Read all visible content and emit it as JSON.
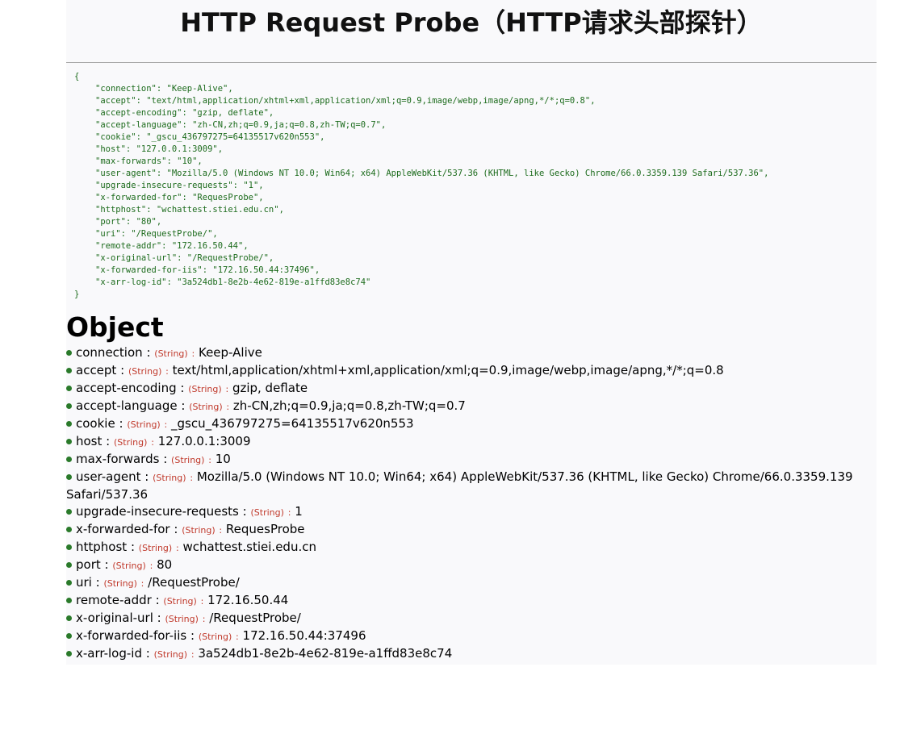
{
  "page": {
    "title": "HTTP Request Probe（HTTP请求头部探针）",
    "object_heading": "Object"
  },
  "raw_json": {
    "open": "{",
    "close": "}",
    "lines": [
      "\"connection\": \"Keep-Alive\",",
      "\"accept\": \"text/html,application/xhtml+xml,application/xml;q=0.9,image/webp,image/apng,*/*;q=0.8\",",
      "\"accept-encoding\": \"gzip, deflate\",",
      "\"accept-language\": \"zh-CN,zh;q=0.9,ja;q=0.8,zh-TW;q=0.7\",",
      "\"cookie\": \"_gscu_436797275=64135517v620n553\",",
      "\"host\": \"127.0.0.1:3009\",",
      "\"max-forwards\": \"10\",",
      "\"user-agent\": \"Mozilla/5.0 (Windows NT 10.0; Win64; x64) AppleWebKit/537.36 (KHTML, like Gecko) Chrome/66.0.3359.139 Safari/537.36\",",
      "\"upgrade-insecure-requests\": \"1\",",
      "\"x-forwarded-for\": \"RequesProbe\",",
      "\"httphost\": \"wchattest.stiei.edu.cn\",",
      "\"port\": \"80\",",
      "\"uri\": \"/RequestProbe/\",",
      "\"remote-addr\": \"172.16.50.44\",",
      "\"x-original-url\": \"/RequestProbe/\",",
      "\"x-forwarded-for-iis\": \"172.16.50.44:37496\",",
      "\"x-arr-log-id\": \"3a524db1-8e2b-4e62-819e-a1ffd83e8c74\""
    ]
  },
  "properties": {
    "type_label": "(String)",
    "separator": ":",
    "items": [
      {
        "key": "connection",
        "value": "Keep-Alive"
      },
      {
        "key": "accept",
        "value": "text/html,application/xhtml+xml,application/xml;q=0.9,image/webp,image/apng,*/*;q=0.8"
      },
      {
        "key": "accept-encoding",
        "value": "gzip, deflate"
      },
      {
        "key": "accept-language",
        "value": "zh-CN,zh;q=0.9,ja;q=0.8,zh-TW;q=0.7"
      },
      {
        "key": "cookie",
        "value": "_gscu_436797275=64135517v620n553"
      },
      {
        "key": "host",
        "value": "127.0.0.1:3009"
      },
      {
        "key": "max-forwards",
        "value": "10"
      },
      {
        "key": "user-agent",
        "value": "Mozilla/5.0 (Windows NT 10.0; Win64; x64) AppleWebKit/537.36 (KHTML, like Gecko) Chrome/66.0.3359.139 Safari/537.36"
      },
      {
        "key": "upgrade-insecure-requests",
        "value": "1"
      },
      {
        "key": "x-forwarded-for",
        "value": "RequesProbe"
      },
      {
        "key": "httphost",
        "value": "wchattest.stiei.edu.cn"
      },
      {
        "key": "port",
        "value": "80"
      },
      {
        "key": "uri",
        "value": "/RequestProbe/"
      },
      {
        "key": "remote-addr",
        "value": "172.16.50.44"
      },
      {
        "key": "x-original-url",
        "value": "/RequestProbe/"
      },
      {
        "key": "x-forwarded-for-iis",
        "value": "172.16.50.44:37496"
      },
      {
        "key": "x-arr-log-id",
        "value": "3a524db1-8e2b-4e62-819e-a1ffd83e8c74"
      }
    ]
  },
  "colors": {
    "raw_text": "#1c6b1c",
    "bullet": "#2a7a2a",
    "type_label": "#c0392b",
    "page_background": "#f9f9fb"
  }
}
